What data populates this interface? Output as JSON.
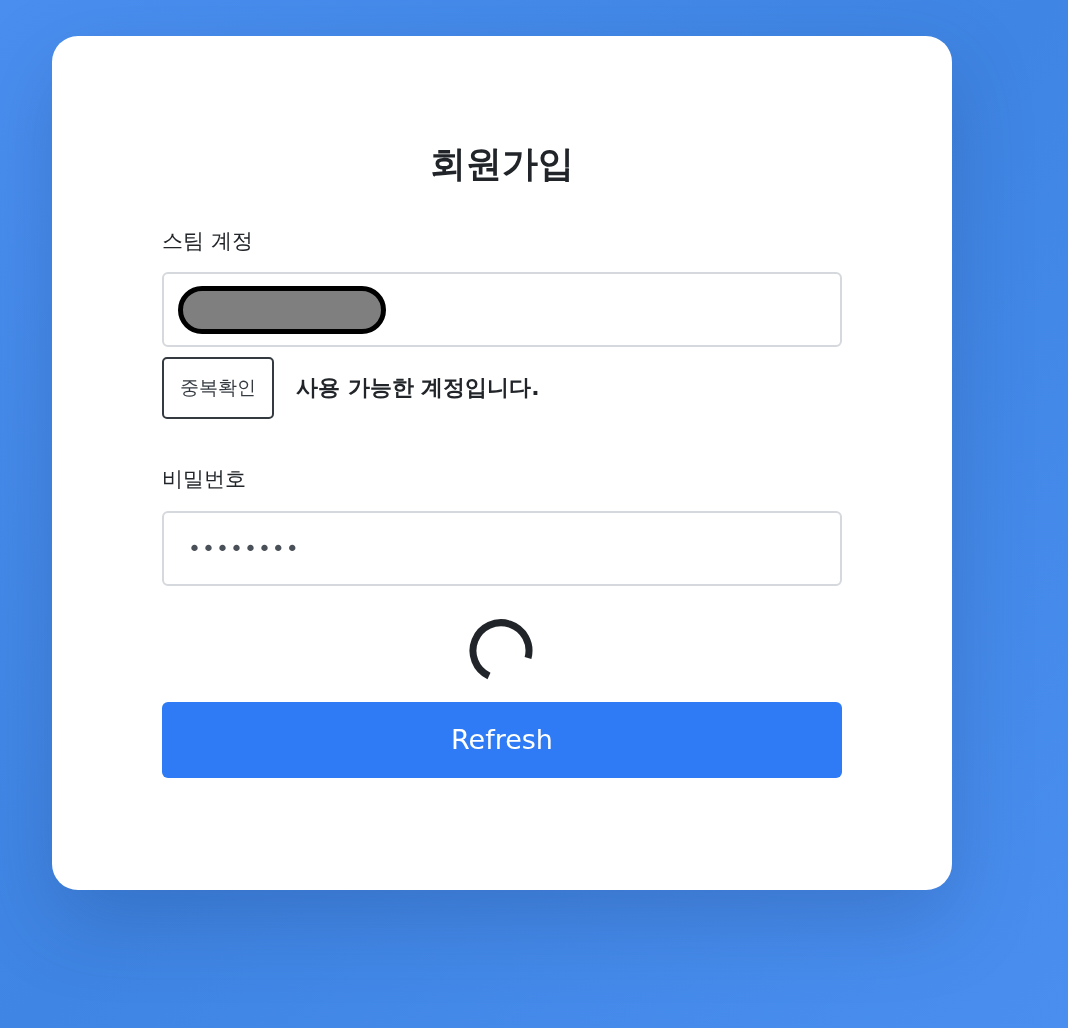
{
  "title": "회원가입",
  "account": {
    "label": "스팀 계정",
    "redacted": true,
    "check_button": "중복확인",
    "message": "사용 가능한 계정입니다."
  },
  "password": {
    "label": "비밀번호",
    "value": "••••••••"
  },
  "loading": true,
  "submit_button": "Refresh"
}
